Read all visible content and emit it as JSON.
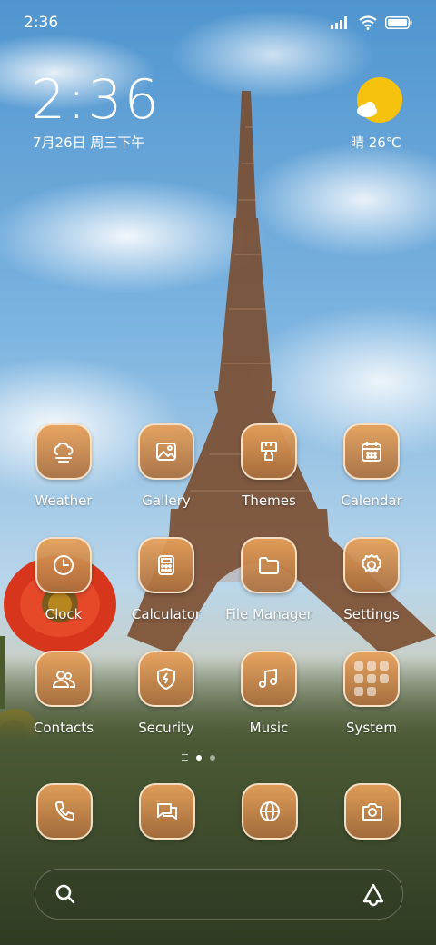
{
  "status_bar": {
    "time": "2:36",
    "icons": [
      "signal-icon",
      "wifi-icon",
      "battery-icon"
    ]
  },
  "clock_widget": {
    "time": "2:36",
    "date": "7月26日 周三下午"
  },
  "weather_widget": {
    "condition_temp": "晴 26℃",
    "icon": "sunny-cloud-icon"
  },
  "apps": [
    {
      "label": "Weather",
      "icon": "weather-icon"
    },
    {
      "label": "Gallery",
      "icon": "gallery-icon"
    },
    {
      "label": "Themes",
      "icon": "themes-brush-icon"
    },
    {
      "label": "Calendar",
      "icon": "calendar-icon"
    },
    {
      "label": "Clock",
      "icon": "clock-icon"
    },
    {
      "label": "Calculator",
      "icon": "calculator-icon"
    },
    {
      "label": "File Manager",
      "icon": "folder-icon"
    },
    {
      "label": "Settings",
      "icon": "gear-icon"
    },
    {
      "label": "Contacts",
      "icon": "contacts-icon"
    },
    {
      "label": "Security",
      "icon": "shield-icon"
    },
    {
      "label": "Music",
      "icon": "music-note-icon"
    },
    {
      "label": "System",
      "icon": "folder-grid-icon"
    }
  ],
  "page_indicator": {
    "pages": 2,
    "current": 1
  },
  "dock": [
    "phone-icon",
    "messages-icon",
    "browser-icon",
    "camera-icon"
  ],
  "search_bar": {
    "icons": [
      "search-icon",
      "assistant-icon"
    ]
  },
  "colors": {
    "tile": "#c98a4f",
    "tile_border": "#fff0dc",
    "sun": "#f6c20e"
  }
}
